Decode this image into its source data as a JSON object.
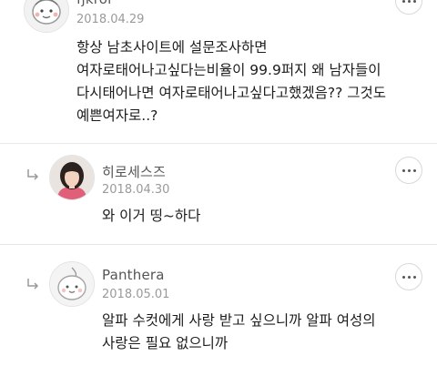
{
  "comments": [
    {
      "username": "fjkrol",
      "date": "2018.04.29",
      "lines": [
        "항상 남초사이트에 설문조사하면",
        "여자로태어나고싶다는비율이 99.9퍼지 왜 남자들이",
        "다시태어나면 여자로태어나고싶다고했겠음?? 그것도",
        "예쁜여자로..?"
      ]
    },
    {
      "username": "히로세스즈",
      "date": "2018.04.30",
      "lines": [
        "와 이거 띵~하다"
      ]
    },
    {
      "username": "Panthera",
      "date": "2018.05.01",
      "lines": [
        "알파 수컷에게 사랑 받고 싶으니까 알파 여성의",
        "사랑은 필요 없으니까"
      ]
    }
  ],
  "icons": {
    "more": "more-options-icon",
    "reply": "reply-arrow-icon"
  },
  "colors": {
    "text": "#1c1c1c",
    "meta": "#9a9a9a",
    "divider": "#e8e8e8"
  }
}
